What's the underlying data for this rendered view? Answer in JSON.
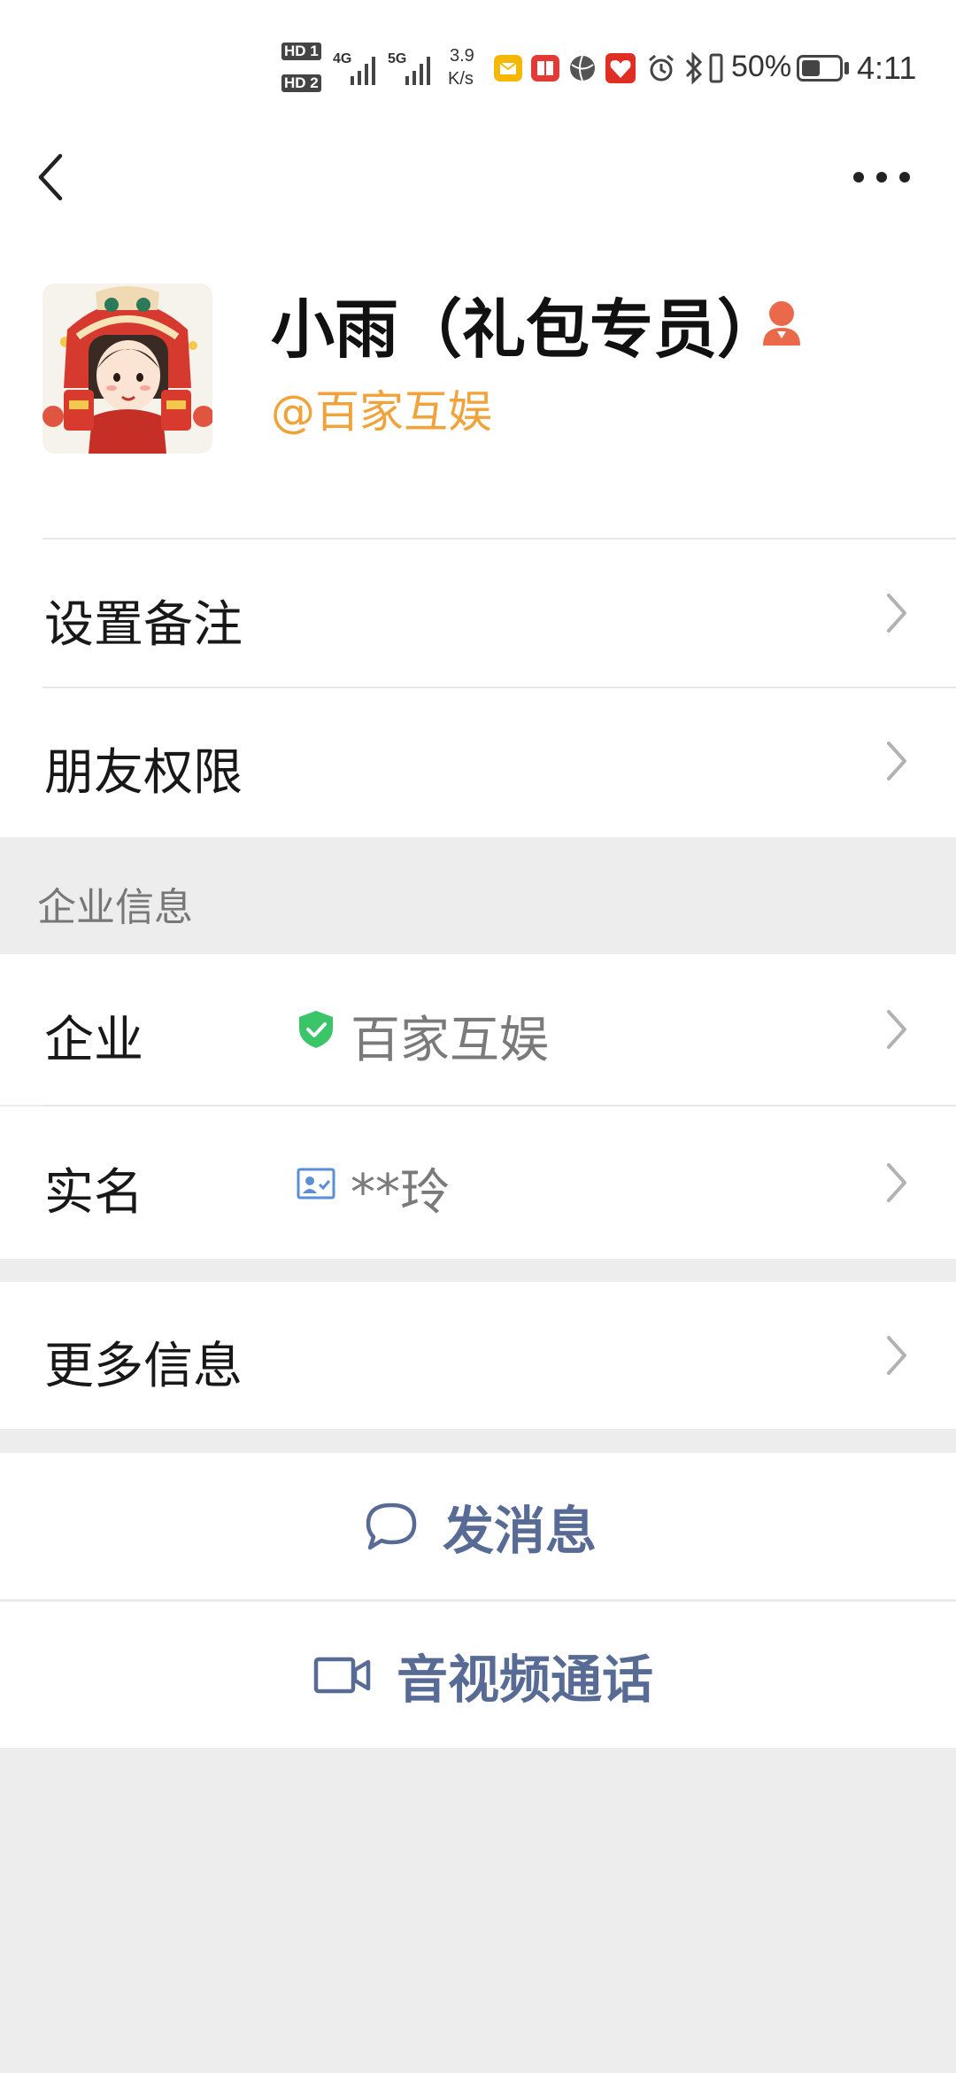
{
  "status_bar": {
    "hd1": "HD 1",
    "hd2": "HD 2",
    "net1": "4G",
    "net2": "5G",
    "speed_value": "3.9",
    "speed_unit": "K/s",
    "battery_percent": "50%",
    "time": "4:11",
    "battery_level": 0.5
  },
  "nav": {
    "back_icon": "chevron-left-icon",
    "more_icon": "more-horizontal-icon"
  },
  "profile": {
    "name": "小雨（礼包专员）",
    "corp_handle": "@百家互娱",
    "name_color": "#111111",
    "corp_color": "#f0a33a",
    "badge_icon": "person-badge-icon",
    "badge_color": "#e9694a"
  },
  "rows": {
    "remark_label": "设置备注",
    "permission_label": "朋友权限"
  },
  "enterprise_section": {
    "title": "企业信息",
    "company_label": "企业",
    "company_value": "百家互娱",
    "company_icon": "verified-shield-icon",
    "realname_label": "实名",
    "realname_value": "**玲",
    "realname_icon": "id-card-icon"
  },
  "more_info_label": "更多信息",
  "actions": {
    "message_label": "发消息",
    "message_icon": "chat-bubble-icon",
    "call_label": "音视频通话",
    "call_icon": "video-camera-icon",
    "link_color": "#576b95"
  }
}
